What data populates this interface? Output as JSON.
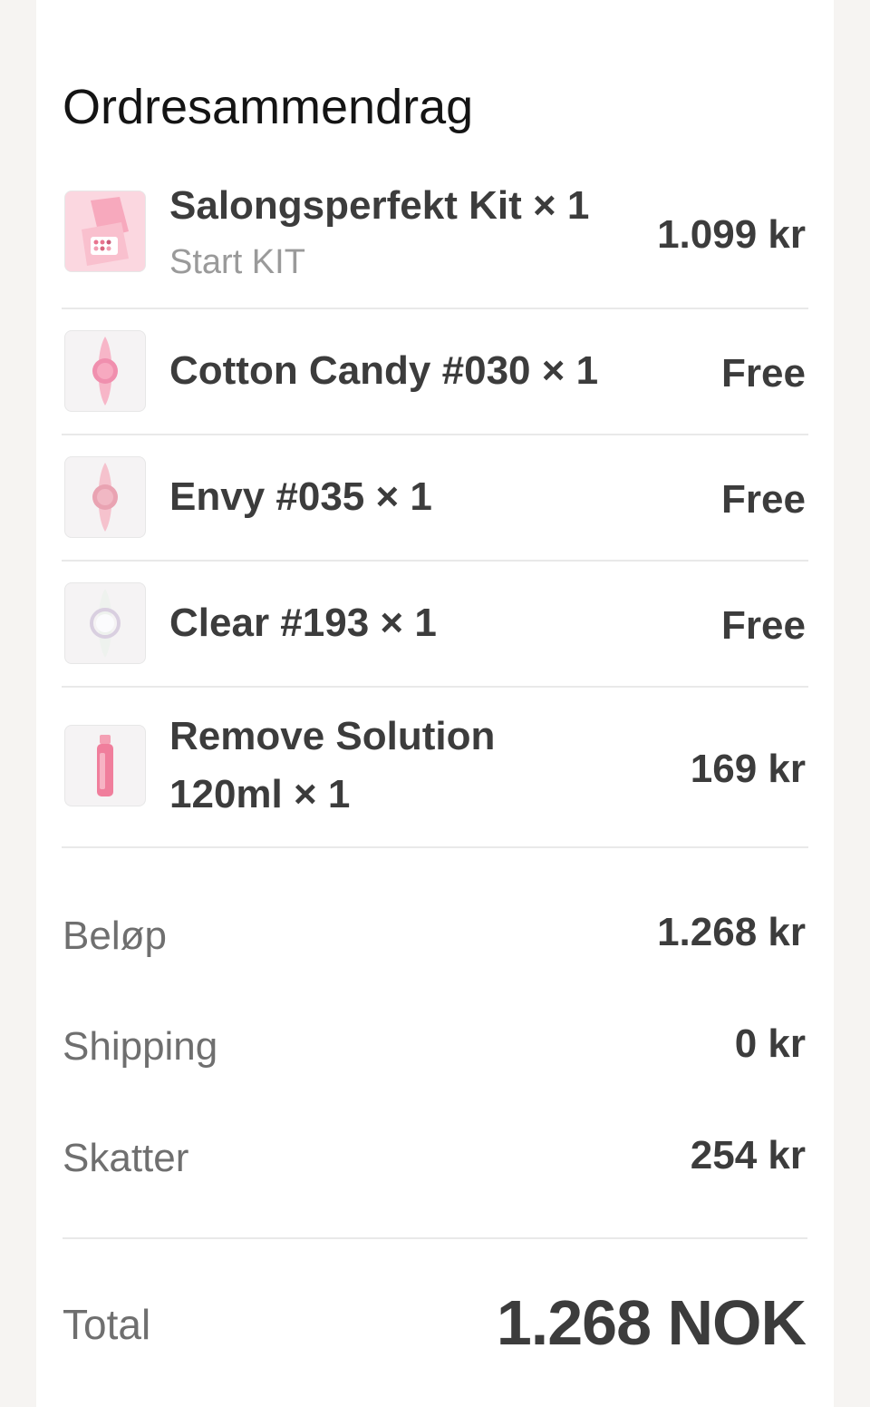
{
  "summary": {
    "title": "Ordresammendrag",
    "items": [
      {
        "name": "Salongsperfekt Kit × 1",
        "subtitle": "Start KIT",
        "price": "1.099 kr",
        "icon": "nail-kit-box-icon"
      },
      {
        "name": "Cotton Candy #030 × 1",
        "price": "Free",
        "icon": "pink-nail-polish-icon"
      },
      {
        "name": "Envy #035 × 1",
        "price": "Free",
        "icon": "rose-nail-polish-icon"
      },
      {
        "name": "Clear #193 × 1",
        "price": "Free",
        "icon": "clear-nail-polish-icon"
      },
      {
        "name_line1": "Remove Solution",
        "name_line2": "120ml × 1",
        "price": "169 kr",
        "icon": "remover-bottle-icon"
      }
    ],
    "amount_label": "Beløp",
    "amount_value": "1.268 kr",
    "shipping_label": "Shipping",
    "shipping_value": "0 kr",
    "tax_label": "Skatter",
    "tax_value": "254 kr",
    "total_label": "Total",
    "total_value": "1.268 NOK"
  },
  "colors": {
    "text_dark": "#3c3c3c",
    "text_muted": "#6f6f6f",
    "divider": "#e9e9e9",
    "accent_pink": "#f4a6bd"
  }
}
